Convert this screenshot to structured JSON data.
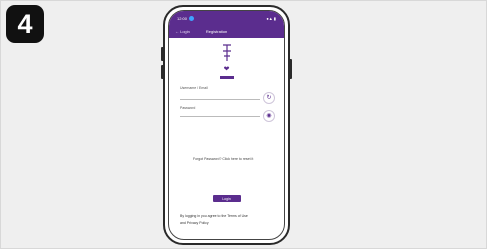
{
  "step": {
    "number": "4"
  },
  "status_bar": {
    "time": "12:00",
    "icons": "●▲ ▮"
  },
  "tabs": [
    {
      "label": "← Login"
    },
    {
      "label": "Registration"
    }
  ],
  "form": {
    "username_label": "Username / Email",
    "password_label": "Password",
    "refresh_icon": "refresh-icon",
    "visibility_icon": "eye-icon"
  },
  "help": {
    "text": "Forgot Password? Click here to reset it"
  },
  "submit": {
    "label": "Login"
  },
  "footer": {
    "line1": "By logging in you agree to the Terms of Use",
    "line2": "and Privacy Policy"
  },
  "colors": {
    "brand": "#5b2d8e",
    "badge": "#111111"
  }
}
